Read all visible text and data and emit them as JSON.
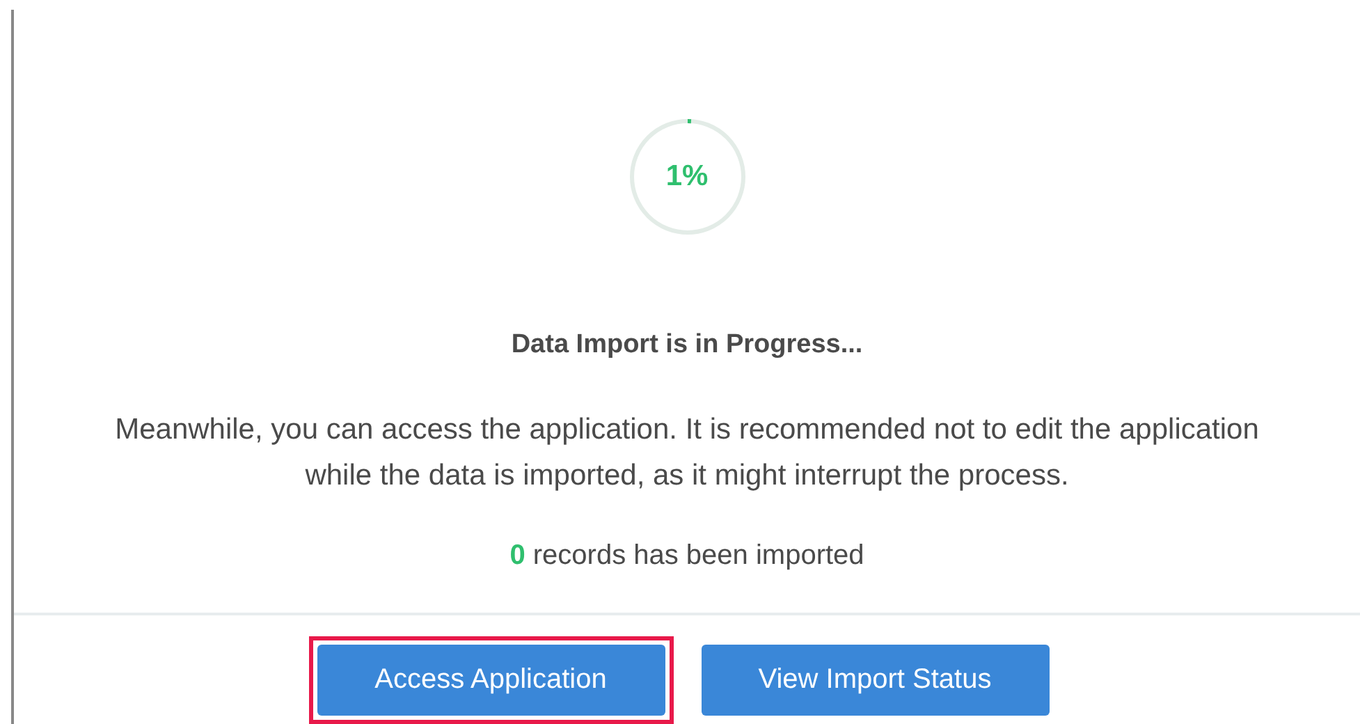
{
  "progress": {
    "level": 0.01,
    "label": "1%"
  },
  "title": "Data Import is in Progress...",
  "message": "Meanwhile, you can access the application. It is recommended not to edit the application while the data is imported, as it might interrupt the process.",
  "records": {
    "count": "0",
    "label": "records has been imported"
  },
  "buttons": [
    {
      "label": "Access Application",
      "highlighted": true
    },
    {
      "label": "View Import Status",
      "highlighted": false
    }
  ]
}
